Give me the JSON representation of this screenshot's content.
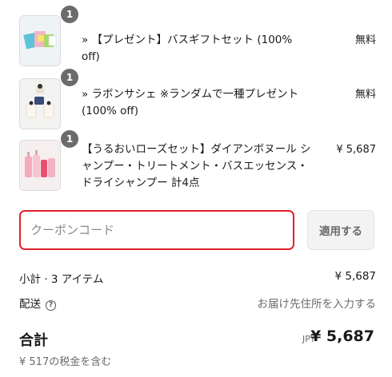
{
  "items": [
    {
      "quantity": "1",
      "title": "» 【プレゼント】バスギフトセット (100% off)",
      "price": "無料"
    },
    {
      "quantity": "1",
      "title": "» ラボンサシェ ※ランダムで一種プレゼント (100% off)",
      "price": "無料"
    },
    {
      "quantity": "1",
      "title": "【うるおいローズセット】ダイアンボヌール シャンプー・トリートメント・バスエッセンス・ドライシャンプー 計4点",
      "price": "¥ 5,687"
    }
  ],
  "coupon": {
    "placeholder": "クーポンコード",
    "value": "",
    "apply_label": "適用する",
    "input_border_color": "#e0232a"
  },
  "summary": {
    "subtotal_label": "小計 · 3 アイテム",
    "subtotal_value": "¥ 5,687",
    "shipping_label": "配送",
    "shipping_help_icon": "question-circle-icon",
    "shipping_value": "お届け先住所を入力する",
    "total_label": "合計",
    "total_currency": "JPY",
    "total_value": "¥ 5,687",
    "tax_note": "¥ 517の税金を含む"
  }
}
